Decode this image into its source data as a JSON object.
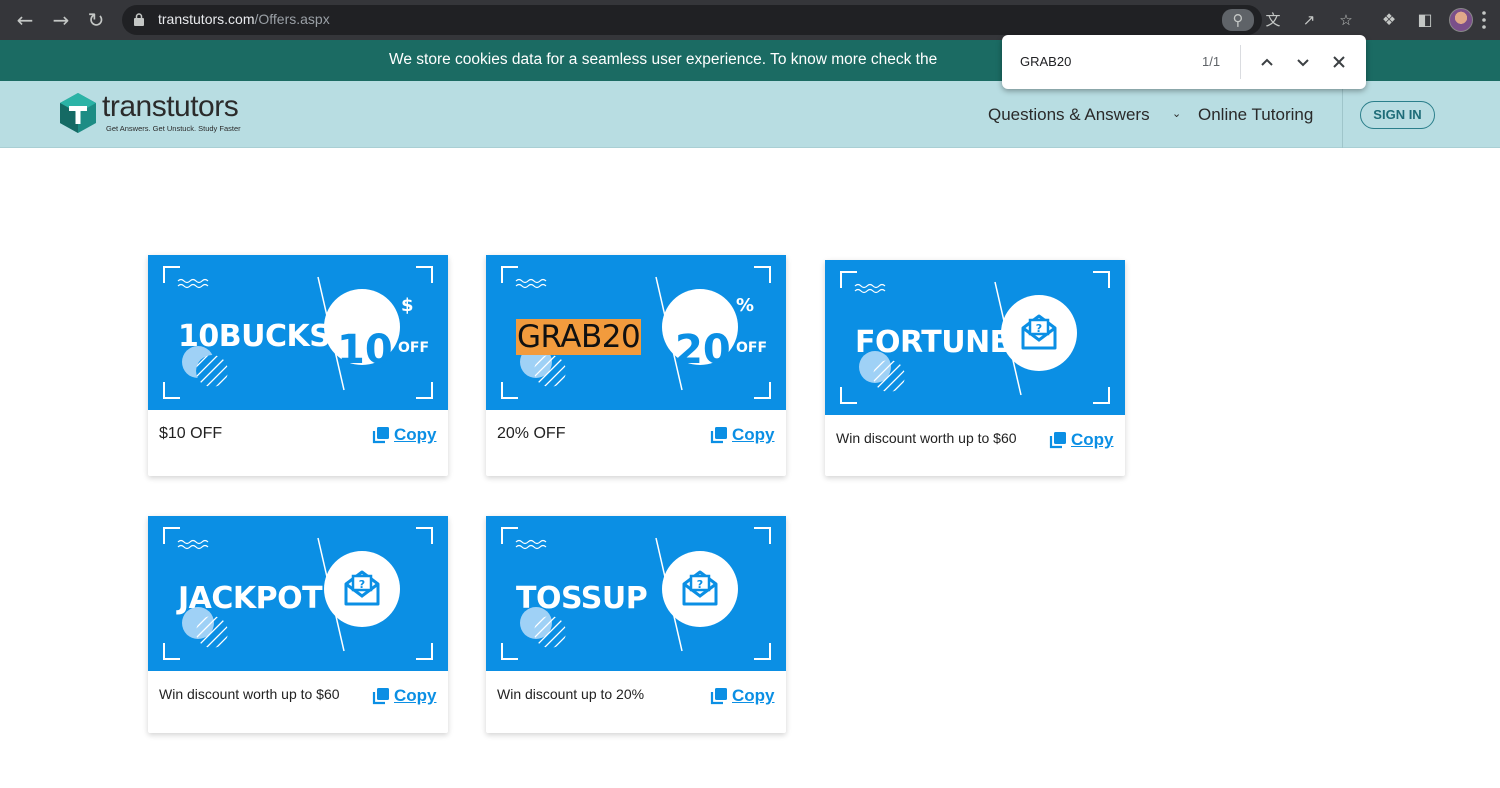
{
  "browser": {
    "url_host": "transtutors.com",
    "url_path": "/Offers.aspx"
  },
  "cookie_banner": {
    "text": "We store cookies data for a seamless user experience. To know more check the"
  },
  "find_bar": {
    "query": "GRAB20",
    "count": "1/1"
  },
  "header": {
    "logo_word": "transtutors",
    "logo_tagline": "Get Answers. Get Unstuck. Study Faster",
    "nav": {
      "qa": "Questions & Answers",
      "tutoring": "Online Tutoring"
    },
    "signin": "SIGN IN"
  },
  "coupons": [
    {
      "code": "10BUCKS",
      "badge_value": "10",
      "badge_unit": "$",
      "badge_off": "OFF",
      "description": "$10 OFF",
      "copy_label": "Copy"
    },
    {
      "code": "GRAB20",
      "badge_value": "20",
      "badge_unit": "%",
      "badge_off": "OFF",
      "description": "20% OFF",
      "copy_label": "Copy"
    },
    {
      "code": "FORTUNE",
      "badge_icon": "mail-question-icon",
      "description": "Win discount worth up to $60",
      "copy_label": "Copy"
    },
    {
      "code": "JACKPOT",
      "badge_icon": "mail-question-icon",
      "description": "Win discount worth up to $60",
      "copy_label": "Copy"
    },
    {
      "code": "TOSSUP",
      "badge_icon": "mail-question-icon",
      "description": "Win discount up to 20%",
      "copy_label": "Copy"
    }
  ],
  "colors": {
    "banner_blue": "#0b8fe4",
    "header_bg": "#b8dde2",
    "cookie_bg": "#1b6b63",
    "find_highlight": "#f29b3d"
  }
}
